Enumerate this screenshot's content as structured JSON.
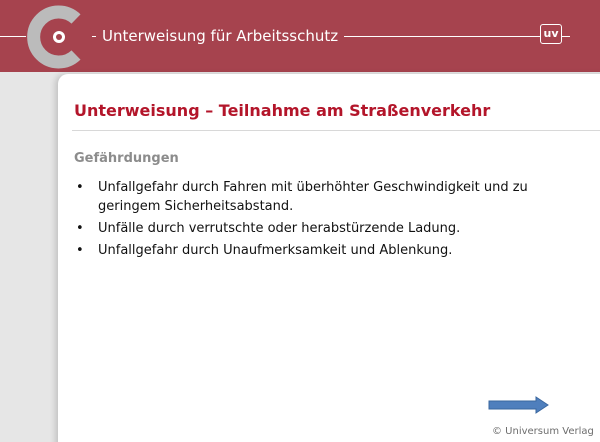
{
  "colors": {
    "header_bg": "#a6434e",
    "title_red": "#b3152a",
    "heading_gray": "#8c8c8c",
    "logo_gray": "#bbbbbb",
    "arrow_blue": "#4f7fbd"
  },
  "header": {
    "logo_icon": "circular-c-logo-icon",
    "title": "Unterweisung für Arbeitsschutz",
    "badge": "uv"
  },
  "slide": {
    "title": "Unterweisung – Teilnahme am Straßenverkehr",
    "section_heading": "Gefährdungen",
    "bullet_symbol": "•",
    "bullets": [
      "Unfallgefahr durch Fahren mit überhöhter Geschwindigkeit und zu geringem Sicherheitsabstand.",
      "Unfälle durch verrutschte oder herabstürzende Ladung.",
      "Unfallgefahr durch Unaufmerksamkeit und Ablenkung."
    ],
    "next_icon": "right-arrow-icon",
    "copyright": "© Universum Verlag"
  }
}
